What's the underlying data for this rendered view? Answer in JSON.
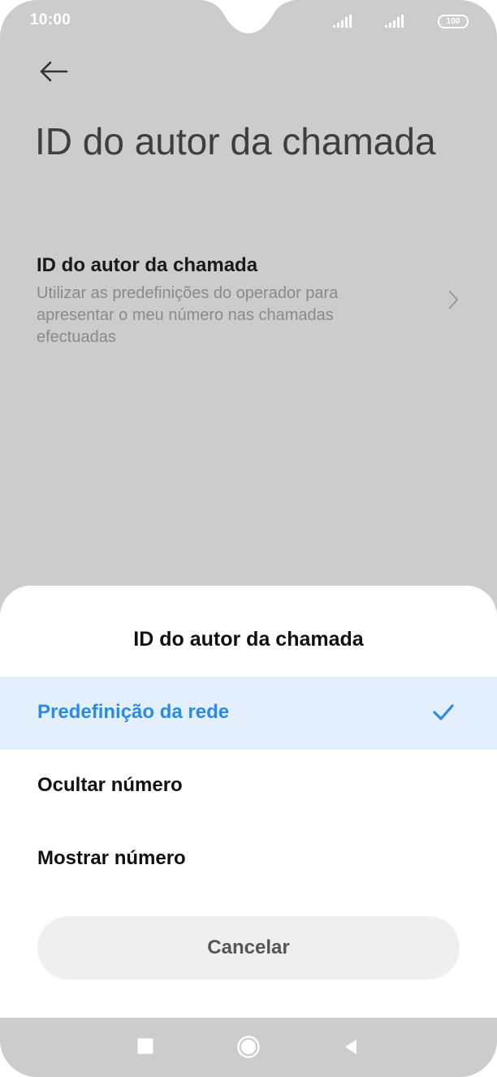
{
  "status_bar": {
    "time": "10:00",
    "battery": "100"
  },
  "page": {
    "title": "ID do autor da chamada"
  },
  "setting": {
    "title": "ID do autor da chamada",
    "description": "Utilizar as predefinições do operador para apresentar o meu número nas chamadas efectuadas"
  },
  "dialog": {
    "title": "ID do autor da chamada",
    "options": [
      {
        "label": "Predefinição da rede",
        "selected": true
      },
      {
        "label": "Ocultar número",
        "selected": false
      },
      {
        "label": "Mostrar número",
        "selected": false
      }
    ],
    "cancel_label": "Cancelar"
  },
  "colors": {
    "accent": "#2a8ae6",
    "selected_bg": "#e3effc",
    "dim_bg": "#cccccc"
  }
}
